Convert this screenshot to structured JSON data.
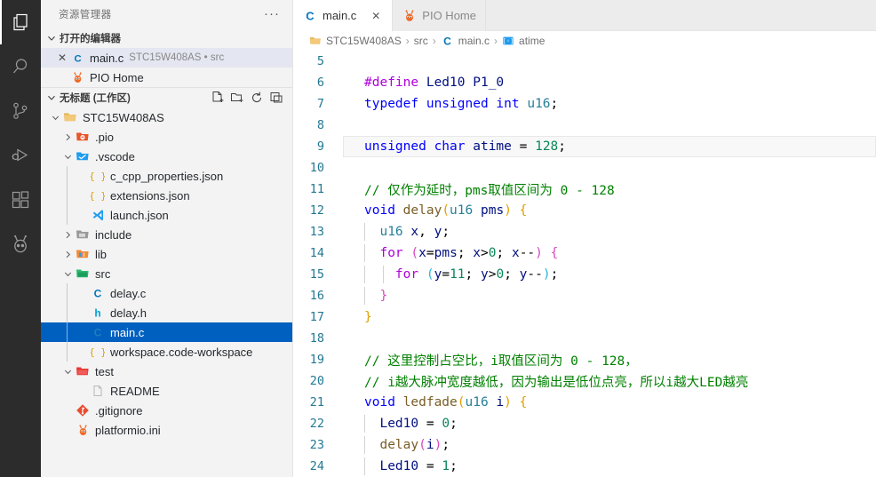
{
  "activity_bar": {
    "items": [
      {
        "name": "explorer",
        "icon": "files-icon",
        "active": true
      },
      {
        "name": "search",
        "icon": "search-icon",
        "active": false
      },
      {
        "name": "source-control",
        "icon": "source-control-icon",
        "active": false
      },
      {
        "name": "run-and-debug",
        "icon": "run-debug-icon",
        "active": false
      },
      {
        "name": "extensions",
        "icon": "extensions-icon",
        "active": false
      },
      {
        "name": "platformio",
        "icon": "platformio-ant-icon",
        "active": false
      }
    ]
  },
  "sidebar": {
    "title": "资源管理器",
    "more_actions": "···",
    "open_editors": {
      "header": "打开的编辑器",
      "items": [
        {
          "name": "main.c",
          "description": "STC15W408AS • src",
          "icon": "c-file-icon",
          "selected": true,
          "closable": true
        },
        {
          "name": "PIO Home",
          "description": "",
          "icon": "platformio-ant-icon",
          "selected": false,
          "closable": false
        }
      ]
    },
    "workspace": {
      "header": "无标题 (工作区)",
      "actions": [
        "new-file-icon",
        "new-folder-icon",
        "refresh-icon",
        "collapse-all-icon"
      ],
      "tree": [
        {
          "label": "STC15W408AS",
          "icon": "folder-root-icon",
          "indent": 0,
          "twisty": "down",
          "type": "folder"
        },
        {
          "label": ".pio",
          "icon": "folder-pio-icon",
          "indent": 1,
          "twisty": "right",
          "type": "folder"
        },
        {
          "label": ".vscode",
          "icon": "folder-vscode-icon",
          "indent": 1,
          "twisty": "down",
          "type": "folder"
        },
        {
          "label": "c_cpp_properties.json",
          "icon": "json-icon",
          "indent": 2,
          "twisty": "none",
          "type": "file"
        },
        {
          "label": "extensions.json",
          "icon": "json-icon",
          "indent": 2,
          "twisty": "none",
          "type": "file"
        },
        {
          "label": "launch.json",
          "icon": "vscode-icon",
          "indent": 2,
          "twisty": "none",
          "type": "file"
        },
        {
          "label": "include",
          "icon": "folder-include-icon",
          "indent": 1,
          "twisty": "right",
          "type": "folder"
        },
        {
          "label": "lib",
          "icon": "folder-lib-icon",
          "indent": 1,
          "twisty": "right",
          "type": "folder"
        },
        {
          "label": "src",
          "icon": "folder-src-icon",
          "indent": 1,
          "twisty": "down",
          "type": "folder"
        },
        {
          "label": "delay.c",
          "icon": "c-file-icon",
          "indent": 2,
          "twisty": "none",
          "type": "file"
        },
        {
          "label": "delay.h",
          "icon": "h-file-icon",
          "indent": 2,
          "twisty": "none",
          "type": "file"
        },
        {
          "label": "main.c",
          "icon": "c-file-icon",
          "indent": 2,
          "twisty": "none",
          "type": "file",
          "selected": true
        },
        {
          "label": "workspace.code-workspace",
          "icon": "json-icon",
          "indent": 2,
          "twisty": "none",
          "type": "file"
        },
        {
          "label": "test",
          "icon": "folder-test-icon",
          "indent": 1,
          "twisty": "down",
          "type": "folder"
        },
        {
          "label": "README",
          "icon": "blank-file-icon",
          "indent": 2,
          "twisty": "none",
          "type": "file"
        },
        {
          "label": ".gitignore",
          "icon": "git-icon",
          "indent": 1,
          "twisty": "none",
          "type": "file"
        },
        {
          "label": "platformio.ini",
          "icon": "platformio-ant-icon",
          "indent": 1,
          "twisty": "none",
          "type": "file"
        }
      ]
    }
  },
  "editor": {
    "tabs": [
      {
        "label": "main.c",
        "icon": "c-file-icon",
        "active": true,
        "close": "✕"
      },
      {
        "label": "PIO Home",
        "icon": "platformio-ant-icon",
        "active": false,
        "close": ""
      }
    ],
    "breadcrumb": [
      {
        "label": "STC15W408AS",
        "icon": "folder-root-icon"
      },
      {
        "label": "src",
        "icon": ""
      },
      {
        "label": "main.c",
        "icon": "c-file-icon"
      },
      {
        "label": "atime",
        "icon": "variable-symbol-icon"
      }
    ],
    "breadcrumb_separator": "›",
    "first_line_number": 5,
    "current_line": 9,
    "lines": [
      {
        "n": 5,
        "text": ""
      },
      {
        "n": 6,
        "text": "#define Led10 P1_0"
      },
      {
        "n": 7,
        "text": "typedef unsigned int u16;"
      },
      {
        "n": 8,
        "text": ""
      },
      {
        "n": 9,
        "text": "unsigned char atime = 128;"
      },
      {
        "n": 10,
        "text": ""
      },
      {
        "n": 11,
        "text": "// 仅作为延时，pms取值区间为 0 - 128"
      },
      {
        "n": 12,
        "text": "void delay(u16 pms) {"
      },
      {
        "n": 13,
        "text": "  u16 x, y;"
      },
      {
        "n": 14,
        "text": "  for (x=pms; x>0; x--) {"
      },
      {
        "n": 15,
        "text": "    for (y=11; y>0; y--);"
      },
      {
        "n": 16,
        "text": "  }"
      },
      {
        "n": 17,
        "text": "}"
      },
      {
        "n": 18,
        "text": ""
      },
      {
        "n": 19,
        "text": "// 这里控制占空比，i取值区间为 0 - 128，"
      },
      {
        "n": 20,
        "text": "// i越大脉冲宽度越低，因为输出是低位点亮，所以i越大LED越亮"
      },
      {
        "n": 21,
        "text": "void ledfade(u16 i) {"
      },
      {
        "n": 22,
        "text": "  Led10 = 0;"
      },
      {
        "n": 23,
        "text": "  delay(i);"
      },
      {
        "n": 24,
        "text": "  Led10 = 1;"
      }
    ]
  },
  "colors": {
    "activity_bar_bg": "#2c2c2c",
    "sidebar_bg": "#f3f3f3",
    "editor_bg": "#ffffff",
    "selection_strong": "#0060c0",
    "selection_soft": "#e4e6f1",
    "line_number": "#237893",
    "comment": "#008000",
    "keyword": "#0000ff",
    "type": "#267f99",
    "number": "#098658",
    "function": "#795e26",
    "preprocessor": "#af00db",
    "variable": "#001080"
  }
}
